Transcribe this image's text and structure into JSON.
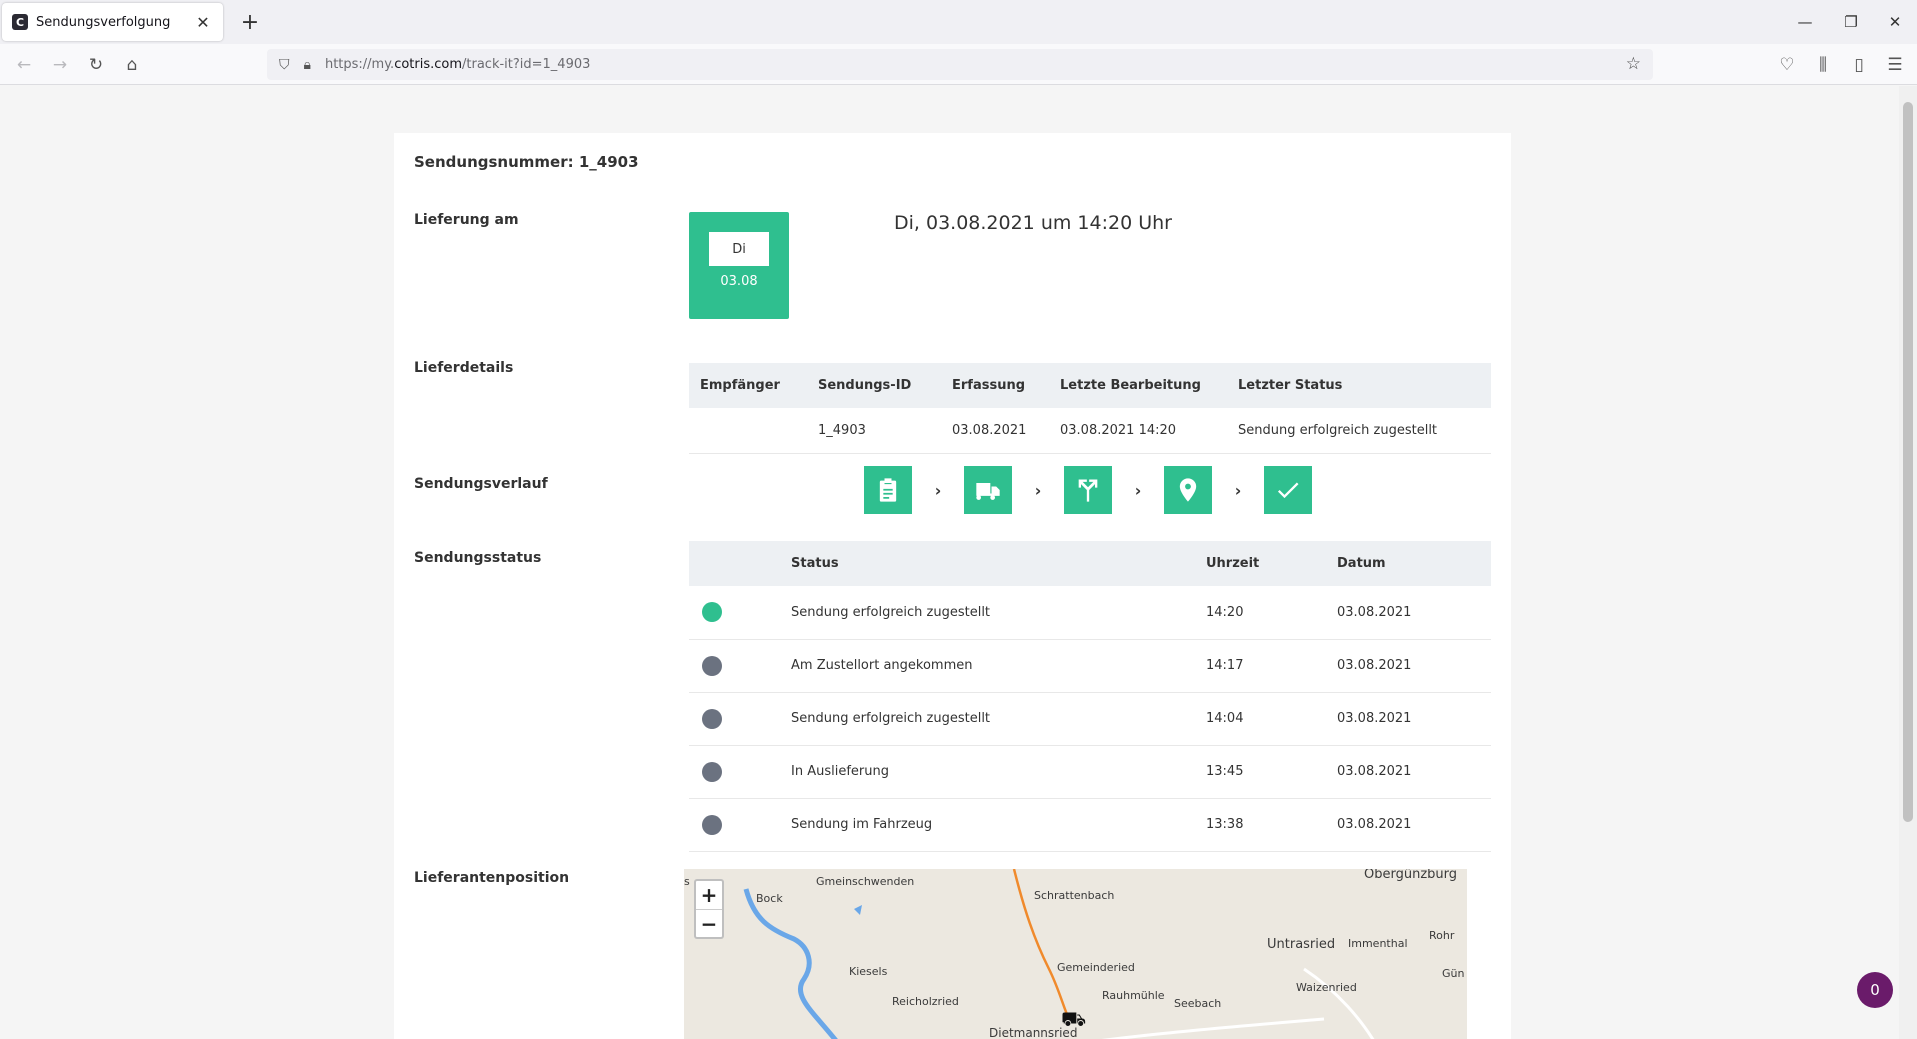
{
  "browser": {
    "tab_title": "Sendungsverfolgung",
    "tab_favicon": "C",
    "url_prefix": "https://my.",
    "url_domain": "cotris.com",
    "url_path": "/track-it?id=1_4903"
  },
  "page": {
    "shipment_title": "Sendungsnummer: 1_4903",
    "delivery_label": "Lieferung am",
    "delivery_day": "Di",
    "delivery_date_short": "03.08",
    "delivery_full": "Di, 03.08.2021 um 14:20 Uhr",
    "details_label": "Lieferdetails",
    "history_label": "Sendungsverlauf",
    "status_label": "Sendungsstatus",
    "position_label": "Lieferantenposition"
  },
  "details": {
    "headers": [
      "Empfänger",
      "Sendungs-ID",
      "Erfassung",
      "Letzte Bearbeitung",
      "Letzter Status"
    ],
    "row": [
      "",
      "1_4903",
      "03.08.2021",
      "03.08.2021 14:20",
      "Sendung erfolgreich zugestellt"
    ]
  },
  "steps": {
    "icons": [
      "clipboard-icon",
      "truck-icon",
      "route-split-icon",
      "location-pin-icon",
      "checkmark-icon"
    ],
    "separator": "›",
    "color": "#2fbf8f"
  },
  "status_table": {
    "headers": [
      "",
      "Status",
      "Uhrzeit",
      "Datum"
    ],
    "rows": [
      {
        "status": "Sendung erfolgreich zugestellt",
        "time": "14:20",
        "date": "03.08.2021",
        "dot": "#2fbf8f"
      },
      {
        "status": "Am Zustellort angekommen",
        "time": "14:17",
        "date": "03.08.2021",
        "dot": "#6b7280"
      },
      {
        "status": "Sendung erfolgreich zugestellt",
        "time": "14:04",
        "date": "03.08.2021",
        "dot": "#6b7280"
      },
      {
        "status": "In Auslieferung",
        "time": "13:45",
        "date": "03.08.2021",
        "dot": "#6b7280"
      },
      {
        "status": "Sendung im Fahrzeug",
        "time": "13:38",
        "date": "03.08.2021",
        "dot": "#6b7280"
      }
    ]
  },
  "map": {
    "zoom_in": "+",
    "zoom_out": "−",
    "places": [
      "Gmeinschwenden",
      "Bock",
      "Schrattenbach",
      "Obergünzburg",
      "Untrasried",
      "Immenthal",
      "Rohr",
      "Kiesels",
      "Gemeinderied",
      "Rauhmühle",
      "Waizenried",
      "Reicholzried",
      "Seebach",
      "Dietmannsried",
      "Gün",
      "s"
    ]
  },
  "chat": {
    "badge": "0"
  }
}
